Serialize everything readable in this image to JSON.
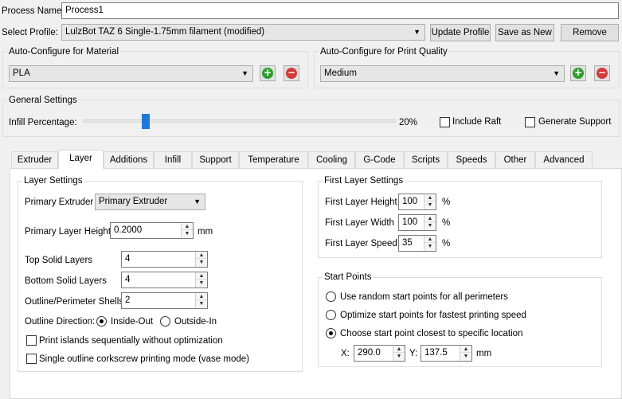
{
  "process": {
    "name_label": "Process Name:",
    "name_value": "Process1"
  },
  "profile": {
    "label": "Select Profile:",
    "value": "LulzBot TAZ 6 Single-1.75mm filament (modified)",
    "update_button": "Update Profile",
    "save_new_button": "Save as New",
    "remove_button": "Remove"
  },
  "material": {
    "title": "Auto-Configure for Material",
    "value": "PLA"
  },
  "quality": {
    "title": "Auto-Configure for Print Quality",
    "value": "Medium"
  },
  "general": {
    "title": "General Settings",
    "infill_label": "Infill Percentage:",
    "infill_value": "20%",
    "infill_fraction": 0.2,
    "raft_label": "Include Raft",
    "support_label": "Generate Support"
  },
  "tabs": [
    {
      "label": "Extruder"
    },
    {
      "label": "Layer"
    },
    {
      "label": "Additions"
    },
    {
      "label": "Infill"
    },
    {
      "label": "Support"
    },
    {
      "label": "Temperature"
    },
    {
      "label": "Cooling"
    },
    {
      "label": "G-Code"
    },
    {
      "label": "Scripts"
    },
    {
      "label": "Speeds"
    },
    {
      "label": "Other"
    },
    {
      "label": "Advanced"
    }
  ],
  "active_tab": "Layer",
  "layer_settings": {
    "title": "Layer Settings",
    "primary_extruder_label": "Primary Extruder",
    "primary_extruder_value": "Primary Extruder",
    "primary_layer_height_label": "Primary Layer Height",
    "primary_layer_height_value": "0.2000",
    "primary_layer_height_unit": "mm",
    "top_solid_label": "Top Solid Layers",
    "top_solid_value": "4",
    "bottom_solid_label": "Bottom Solid Layers",
    "bottom_solid_value": "4",
    "shells_label": "Outline/Perimeter Shells",
    "shells_value": "2",
    "outline_direction_label": "Outline Direction:",
    "inside_out_label": "Inside-Out",
    "outside_in_label": "Outside-In",
    "print_islands_label": "Print islands sequentially without optimization",
    "single_outline_label": "Single outline corkscrew printing mode (vase mode)"
  },
  "first_layer": {
    "title": "First Layer Settings",
    "height_label": "First Layer Height",
    "height_value": "100",
    "width_label": "First Layer Width",
    "width_value": "100",
    "speed_label": "First Layer Speed",
    "speed_value": "35",
    "unit": "%"
  },
  "start_points": {
    "title": "Start Points",
    "random_label": "Use random start points for all perimeters",
    "optimize_label": "Optimize start points for fastest printing speed",
    "closest_label": "Choose start point closest to specific location",
    "x_label": "X:",
    "x_value": "290.0",
    "y_label": "Y:",
    "y_value": "137.5",
    "unit": "mm"
  },
  "colors": {
    "add_green": "#2e9e2e",
    "remove_red": "#d43a3a",
    "slider_thumb": "#1e78d7"
  }
}
